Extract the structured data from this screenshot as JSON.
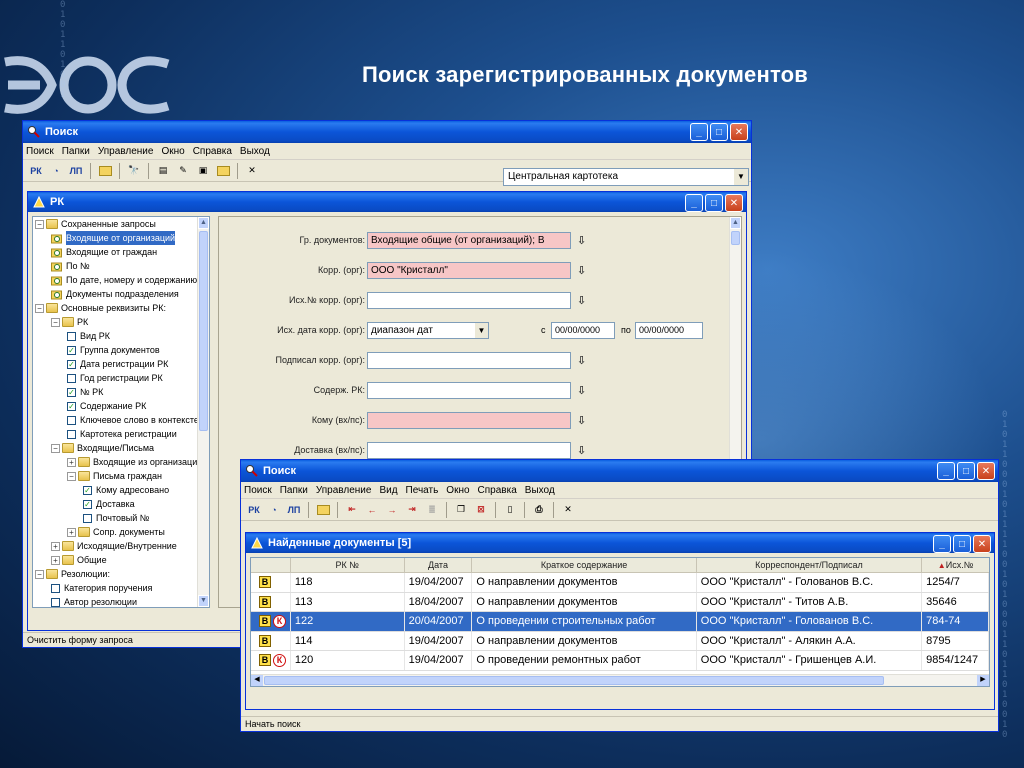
{
  "slide": {
    "title": "Поиск зарегистрированных документов"
  },
  "decor": {
    "binary_left": "0 1 0 1 1 0 1 0 0 1",
    "binary_right": "010110001011110010100011011010010"
  },
  "main_window": {
    "title": "Поиск",
    "menu": [
      "Поиск",
      "Папки",
      "Управление",
      "Окно",
      "Справка",
      "Выход"
    ],
    "toolbar_icons": [
      "rk-icon",
      "rk-search-icon",
      "rk-card-icon",
      "folder-icon",
      "binoculars-icon",
      "form-icon",
      "edit-icon",
      "image-icon",
      "open-folder-icon",
      "close-x-icon"
    ],
    "cabinet_select": "Центральная картотека",
    "status": "Очистить форму запроса",
    "child": {
      "title": "РК",
      "tree": [
        {
          "level": 0,
          "type": "folder",
          "pm": "-",
          "label": "Сохраненные запросы"
        },
        {
          "level": 1,
          "type": "query",
          "label": "Входящие от организаций",
          "selected": true
        },
        {
          "level": 1,
          "type": "query",
          "label": "Входящие от граждан"
        },
        {
          "level": 1,
          "type": "query",
          "label": "По №"
        },
        {
          "level": 1,
          "type": "query",
          "label": "По дате, номеру и содержанию"
        },
        {
          "level": 1,
          "type": "query",
          "label": "Документы подразделения"
        },
        {
          "level": 0,
          "type": "folder",
          "pm": "-",
          "label": "Основные реквизиты РК:"
        },
        {
          "level": 1,
          "type": "folder",
          "pm": "-",
          "label": "РК"
        },
        {
          "level": 2,
          "type": "check",
          "checked": false,
          "label": "Вид РК"
        },
        {
          "level": 2,
          "type": "check",
          "checked": true,
          "label": "Группа документов"
        },
        {
          "level": 2,
          "type": "check",
          "checked": true,
          "label": "Дата регистрации РК"
        },
        {
          "level": 2,
          "type": "check",
          "checked": false,
          "label": "Год регистрации РК"
        },
        {
          "level": 2,
          "type": "check",
          "checked": true,
          "label": "№ РК"
        },
        {
          "level": 2,
          "type": "check",
          "checked": true,
          "label": "Содержание РК"
        },
        {
          "level": 2,
          "type": "check",
          "checked": false,
          "label": "Ключевое слово в контексте"
        },
        {
          "level": 2,
          "type": "check",
          "checked": false,
          "label": "Картотека регистрации"
        },
        {
          "level": 1,
          "type": "folder",
          "pm": "-",
          "label": "Входящие/Письма"
        },
        {
          "level": 2,
          "type": "folder",
          "pm": "+",
          "label": "Входящие из организаций"
        },
        {
          "level": 2,
          "type": "folder",
          "pm": "-",
          "label": "Письма граждан"
        },
        {
          "level": 3,
          "type": "check",
          "checked": true,
          "label": "Кому адресовано"
        },
        {
          "level": 3,
          "type": "check",
          "checked": true,
          "label": "Доставка"
        },
        {
          "level": 3,
          "type": "check",
          "checked": false,
          "label": "Почтовый №"
        },
        {
          "level": 2,
          "type": "folder",
          "pm": "+",
          "label": "Сопр. документы"
        },
        {
          "level": 1,
          "type": "folder",
          "pm": "+",
          "label": "Исходящие/Внутренние"
        },
        {
          "level": 1,
          "type": "folder",
          "pm": "+",
          "label": "Общие"
        },
        {
          "level": 0,
          "type": "folder",
          "pm": "-",
          "label": "Резолюции:"
        },
        {
          "level": 1,
          "type": "check",
          "checked": false,
          "label": "Категория поручения"
        },
        {
          "level": 1,
          "type": "check",
          "checked": false,
          "label": "Автор резолюции"
        }
      ],
      "form": {
        "doc_group_label": "Гр. документов:",
        "doc_group_value": "Входящие общие (от организаций); В",
        "corr_label": "Корр. (орг):",
        "corr_value": "ООО \"Кристалл\"",
        "out_no_label": "Исх.№ корр. (орг):",
        "out_no_value": "",
        "out_date_label": "Исх. дата корр. (орг):",
        "out_date_mode": "диапазон дат",
        "from_label": "с",
        "from_value": "00/00/0000",
        "to_label": "по",
        "to_value": "00/00/0000",
        "signed_label": "Подписал корр. (орг):",
        "signed_value": "",
        "content_label": "Содерж. РК:",
        "content_value": "",
        "whom_label": "Кому (вх/пс):",
        "whom_value": "",
        "delivery_label": "Доставка (вх/пс):",
        "delivery_value": ""
      }
    }
  },
  "results_window": {
    "title": "Поиск",
    "menu": [
      "Поиск",
      "Папки",
      "Управление",
      "Вид",
      "Печать",
      "Окно",
      "Справка",
      "Выход"
    ],
    "status": "Начать поиск",
    "child": {
      "title": "Найденные документы",
      "count_label": "[5]",
      "columns": [
        "",
        "РК №",
        "Дата",
        "Краткое содержание",
        "Корреспондент/Подписал",
        "Исх.№"
      ],
      "rows": [
        {
          "icons": "B",
          "rk": "118",
          "date": "19/04/2007",
          "summary": "О направлении документов",
          "corr": "ООО \"Кристалл\" - Голованов В.С.",
          "out": "1254/7",
          "selected": false
        },
        {
          "icons": "B",
          "rk": "113",
          "date": "18/04/2007",
          "summary": "О направлении документов",
          "corr": "ООО \"Кристалл\" - Титов А.В.",
          "out": "35646",
          "selected": false
        },
        {
          "icons": "BK",
          "rk": "122",
          "date": "20/04/2007",
          "summary": "О проведении строительных работ",
          "corr": "ООО \"Кристалл\" - Голованов В.С.",
          "out": "784-74",
          "selected": true
        },
        {
          "icons": "B",
          "rk": "114",
          "date": "19/04/2007",
          "summary": "О направлении документов",
          "corr": "ООО \"Кристалл\" - Алякин А.А.",
          "out": "8795",
          "selected": false
        },
        {
          "icons": "BK",
          "rk": "120",
          "date": "19/04/2007",
          "summary": "О проведении ремонтных работ",
          "corr": "ООО \"Кристалл\" - Гришенцев А.И.",
          "out": "9854/1247",
          "selected": false
        }
      ]
    }
  }
}
